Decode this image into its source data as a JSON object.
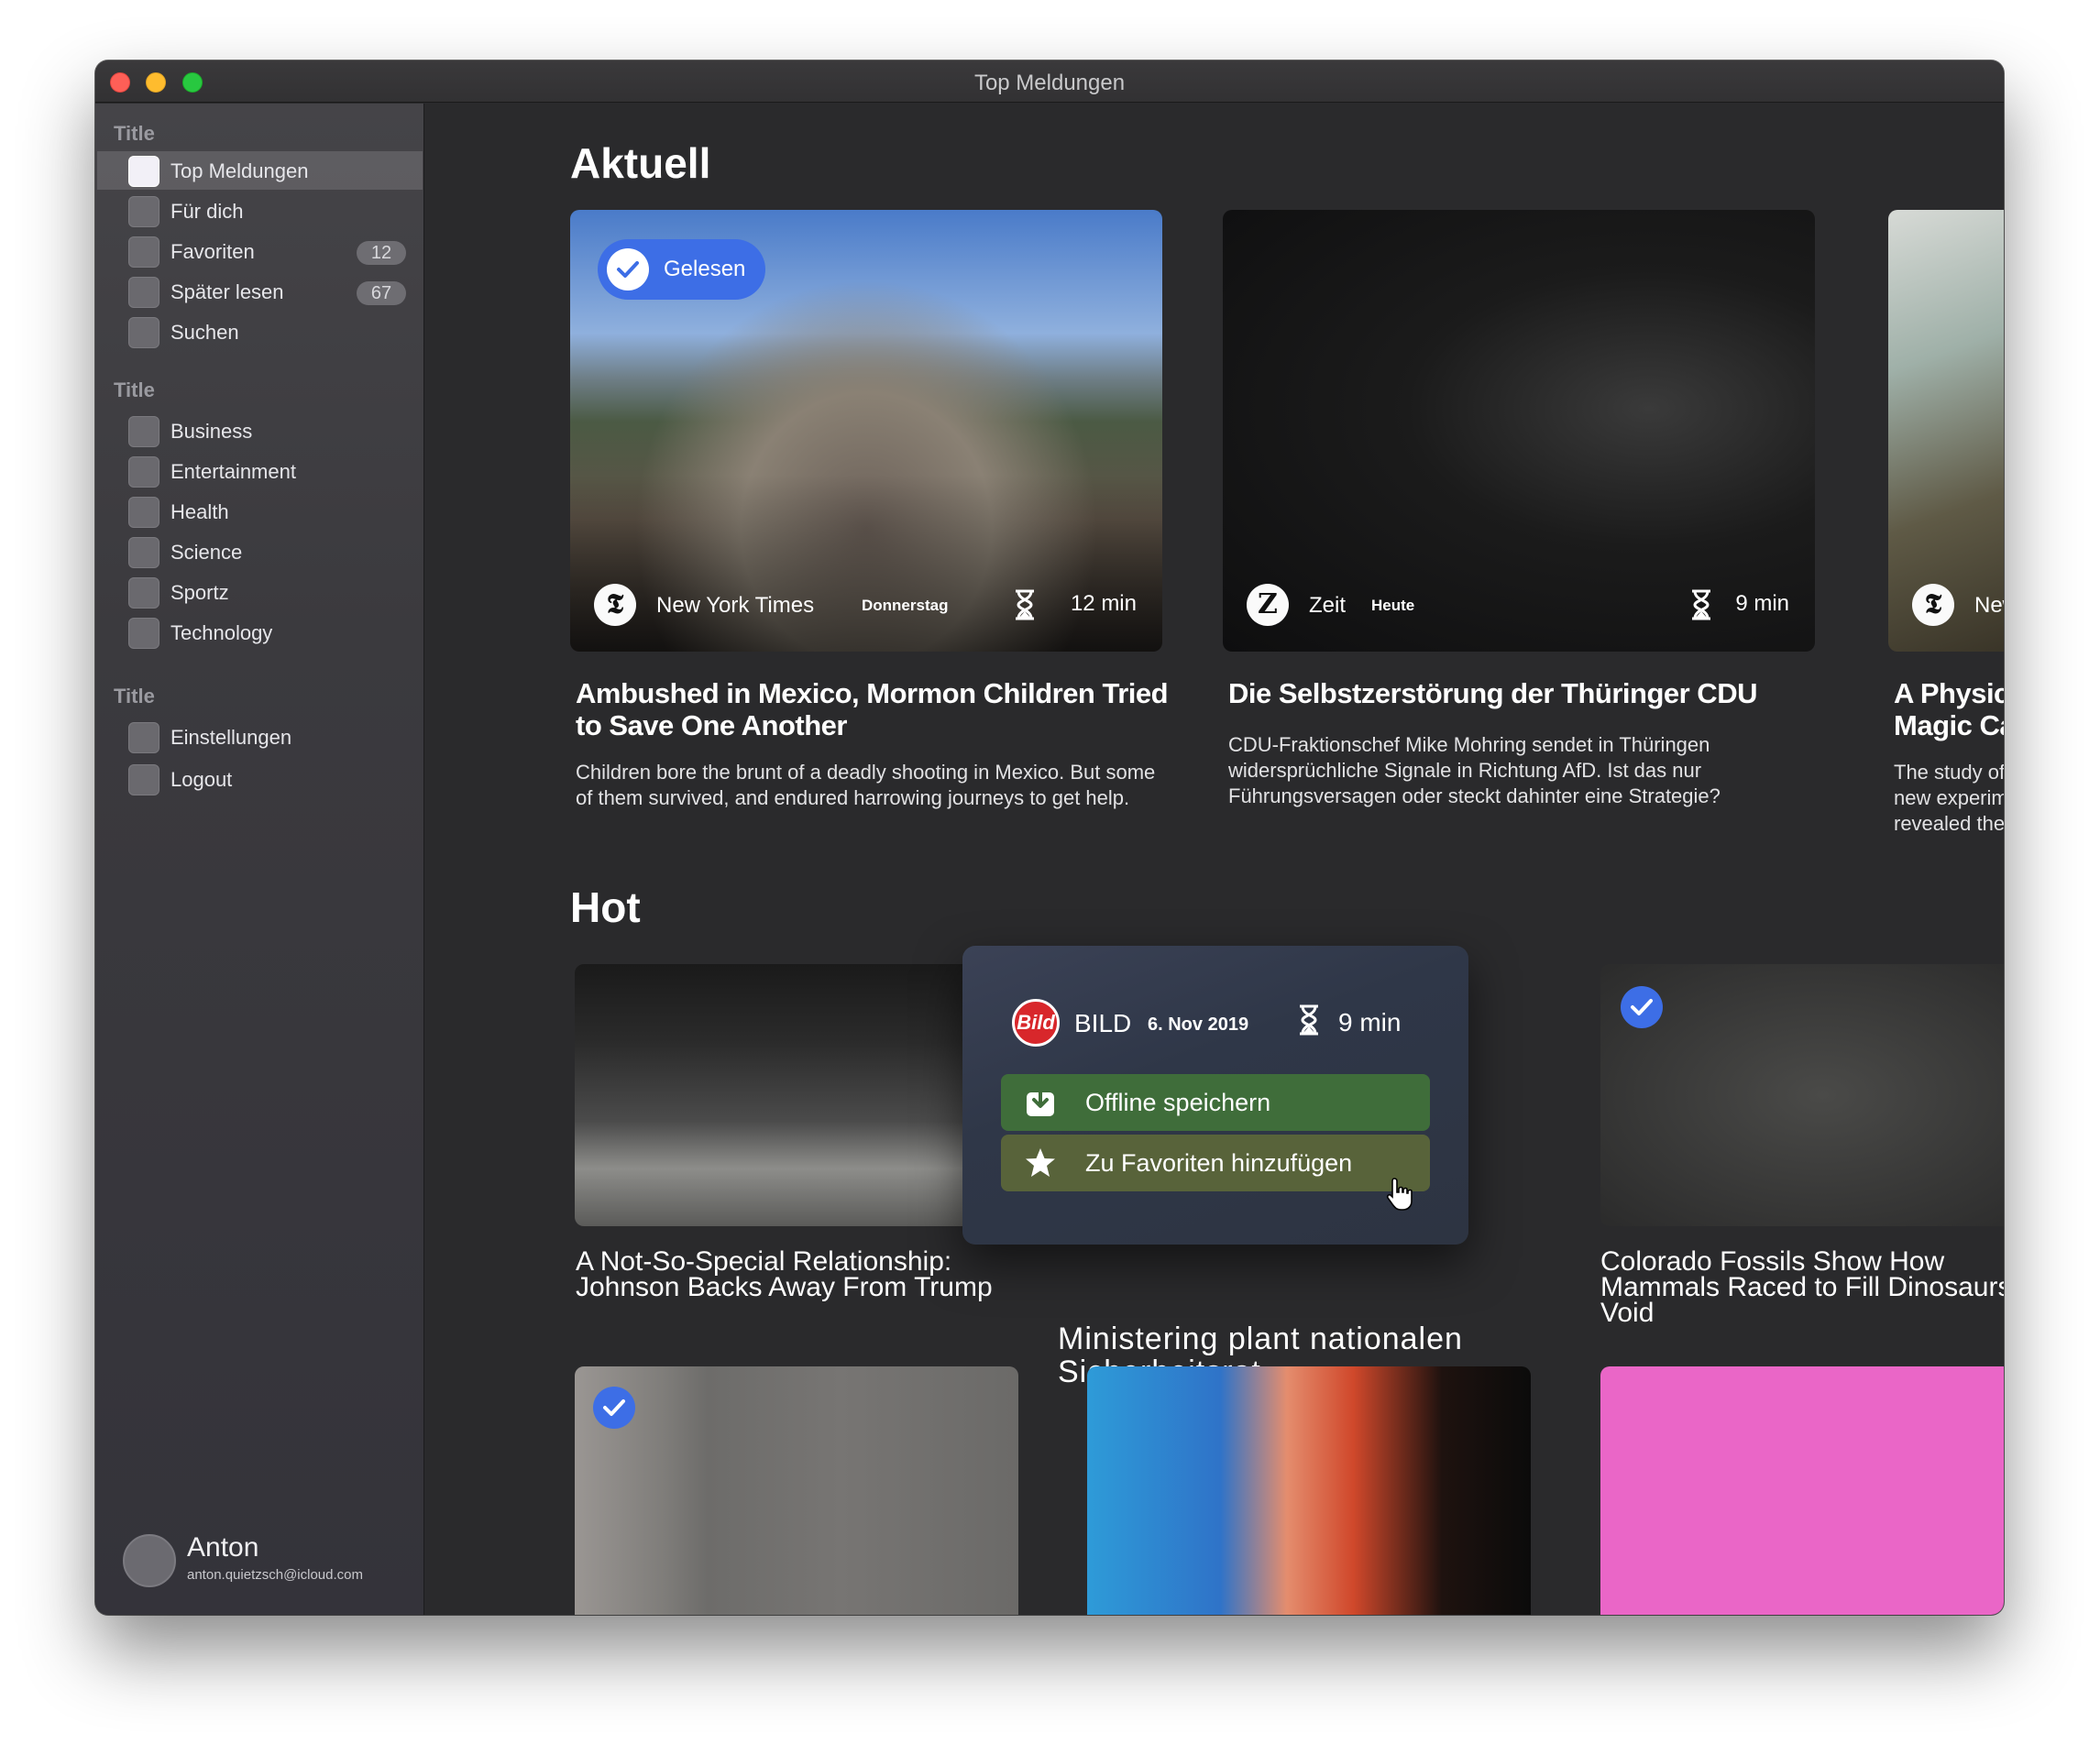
{
  "window": {
    "title": "Top Meldungen"
  },
  "sidebar": {
    "sections": [
      {
        "title": "Title",
        "items": [
          {
            "label": "Top Meldungen",
            "badge": ""
          },
          {
            "label": "Für dich",
            "badge": ""
          },
          {
            "label": "Favoriten",
            "badge": "12"
          },
          {
            "label": "Später lesen",
            "badge": "67"
          },
          {
            "label": "Suchen",
            "badge": ""
          }
        ]
      },
      {
        "title": "Title",
        "items": [
          {
            "label": "Business"
          },
          {
            "label": "Entertainment"
          },
          {
            "label": "Health"
          },
          {
            "label": "Science"
          },
          {
            "label": "Sportz"
          },
          {
            "label": "Technology"
          }
        ]
      },
      {
        "title": "Title",
        "items": [
          {
            "label": "Einstellungen"
          },
          {
            "label": "Logout"
          }
        ]
      }
    ],
    "user": {
      "name": "Anton",
      "email": "anton.quietzsch@icloud.com"
    }
  },
  "aktuell": {
    "heading": "Aktuell",
    "cards": [
      {
        "badge": "Gelesen",
        "source": "New York Times",
        "date": "Donnerstag",
        "read_time": "12 min",
        "title": "Ambushed in Mexico, Mormon Children Tried to Save One Another",
        "description": "Children bore the brunt of a deadly shooting in Mexico. But some of them survived, and endured harrowing journeys to get help."
      },
      {
        "source": "Zeit",
        "date": "Heute",
        "read_time": "9 min",
        "title": "Die Selbstzerstörung der Thüringer CDU",
        "description": "CDU-Fraktionschef Mike Mohring sendet in Thüringen widersprüchliche Signale in Richtung AfD. Ist das nur Führungsversagen oder steckt dahinter eine Strategie?"
      },
      {
        "source": "New York Tir",
        "title": "A Physics Magic Carbon and Twi",
        "description": "The study of graphen new experiments witl revealed there was m"
      }
    ]
  },
  "hot": {
    "heading": "Hot",
    "cards": [
      {
        "title": "A Not-So-Special Relationship: Johnson Backs Away From Trump"
      },
      {
        "title": "Ministering plant nationalen Sicherheitsrat",
        "popover": {
          "source_logo": "Bild",
          "source": "BILD",
          "date": "6. Nov 2019",
          "read_time": "9 min",
          "actions": [
            "Offline speichern",
            "Zu Favoriten hinzufügen"
          ]
        }
      },
      {
        "title": "Colorado Fossils Show How Mammals Raced to Fill Dinosaurs' Void"
      }
    ]
  },
  "colors": {
    "accent": "#3d6ee6",
    "background": "#2a2a2c",
    "sidebar": "#3b3a3e"
  },
  "icons": [
    "check-icon",
    "hourglass-icon",
    "download-icon",
    "star-icon",
    "pointer-cursor-icon"
  ]
}
